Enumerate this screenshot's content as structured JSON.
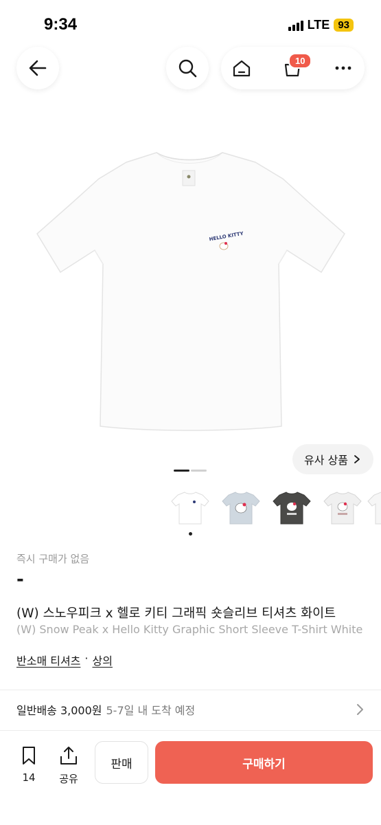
{
  "status": {
    "time": "9:34",
    "network": "LTE",
    "battery": "93"
  },
  "nav": {
    "cart_count": "10"
  },
  "gallery": {
    "similar_label": "유사 상품",
    "thumbnail_count": 5
  },
  "product": {
    "instant_buy_status": "즉시 구매가 없음",
    "price": "-",
    "title_ko": "(W) 스노우피크 x 헬로 키티 그래픽 숏슬리브 티셔츠 화이트",
    "title_en": "(W) Snow Peak x Hello Kitty Graphic Short Sleeve T-Shirt White",
    "category": "반소매 티셔츠",
    "category_sep": "·",
    "parent_category": "상의",
    "print_text": "HELLO KITTY"
  },
  "shipping": {
    "label": "일반배송 3,000원",
    "eta": "5-7일 내 도착 예정"
  },
  "bottom": {
    "wish_count": "14",
    "share_label": "공유",
    "sell_label": "판매",
    "buy_label": "구매하기"
  },
  "colors": {
    "accent": "#ef6253",
    "badge": "#f05a4a",
    "battery": "#f4c40f"
  },
  "icons": [
    "back-arrow-icon",
    "search-icon",
    "home-icon",
    "cart-icon",
    "more-icon",
    "chevron-right-icon",
    "bookmark-icon",
    "share-icon"
  ]
}
